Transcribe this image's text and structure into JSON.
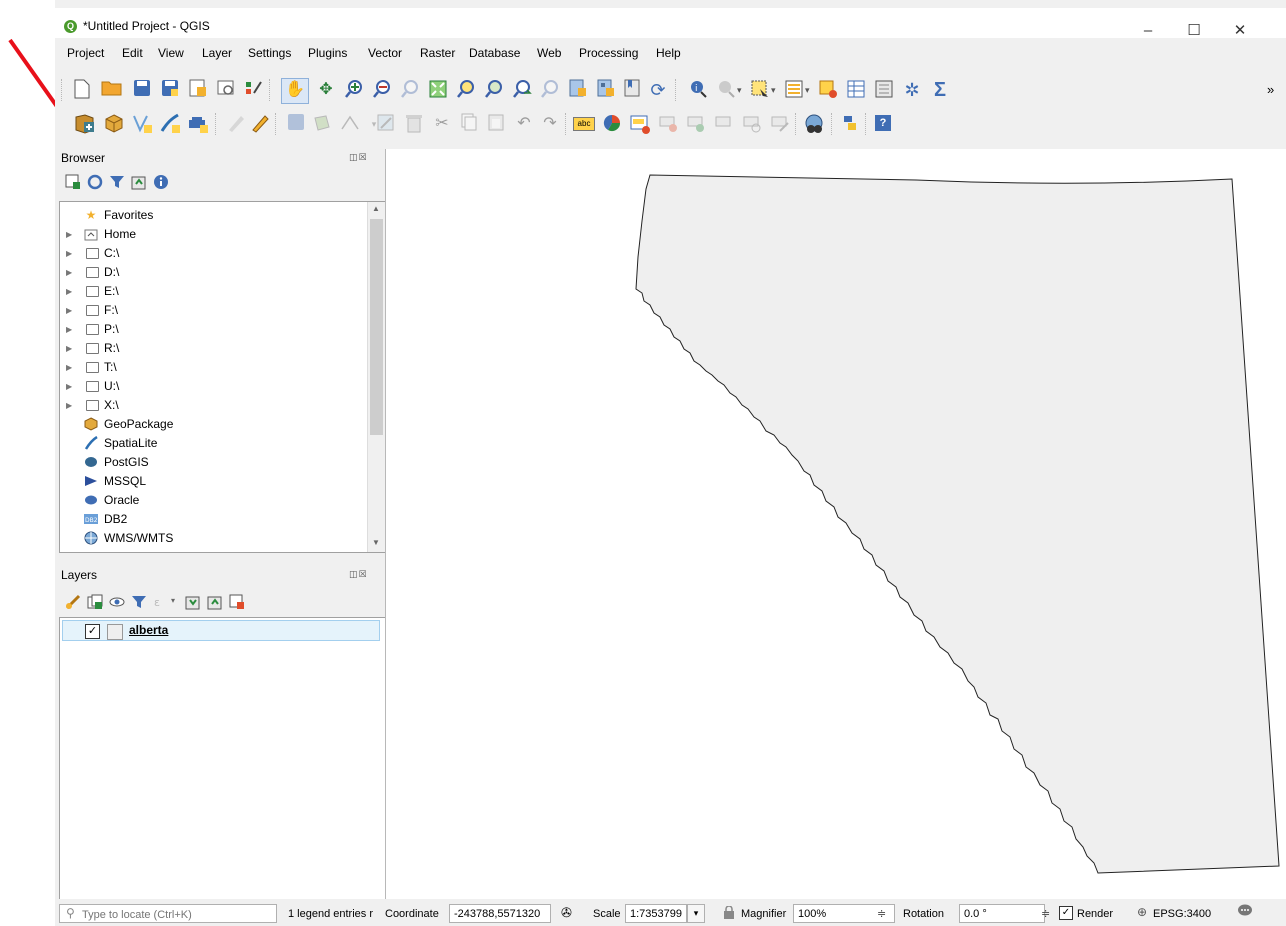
{
  "window": {
    "title": "*Untitled Project - QGIS",
    "logo": "Q",
    "minimize": "–",
    "maximize": "☐",
    "close": "✕"
  },
  "menu": [
    "Project",
    "Edit",
    "View",
    "Layer",
    "Settings",
    "Plugins",
    "Vector",
    "Raster",
    "Database",
    "Web",
    "Processing",
    "Help"
  ],
  "toolbar": {
    "overflow": "»",
    "help_glyph": "?",
    "label_glyph": "abc",
    "sum_glyph": "Σ"
  },
  "browser": {
    "title": "Browser",
    "items": [
      "Favorites",
      "Home",
      "C:\\",
      "D:\\",
      "E:\\",
      "F:\\",
      "P:\\",
      "R:\\",
      "T:\\",
      "U:\\",
      "X:\\",
      "GeoPackage",
      "SpatiaLite",
      "PostGIS",
      "MSSQL",
      "Oracle",
      "DB2",
      "WMS/WMTS"
    ]
  },
  "layers": {
    "title": "Layers",
    "items": [
      {
        "name": "alberta",
        "checked": "✓"
      }
    ]
  },
  "status": {
    "locate_placeholder": "Type to locate (Ctrl+K)",
    "legend_msg": "1 legend entries r",
    "coordinate_label": "Coordinate",
    "coordinate_value": "-243788,5571320",
    "scale_label": "Scale",
    "scale_value": "1:7353799",
    "magnifier_label": "Magnifier",
    "magnifier_value": "100%",
    "rotation_label": "Rotation",
    "rotation_value": "0.0 °",
    "render_label": "Render",
    "render_checked": "✓",
    "crs": "EPSG:3400",
    "stepper_glyph": "≑",
    "dropdown_glyph": "▾"
  },
  "colors": {
    "annotation_arrow": "#e8101a",
    "polygon_fill": "#efefef",
    "polygon_stroke": "#222222",
    "qgis_green": "#4a9a2c"
  }
}
